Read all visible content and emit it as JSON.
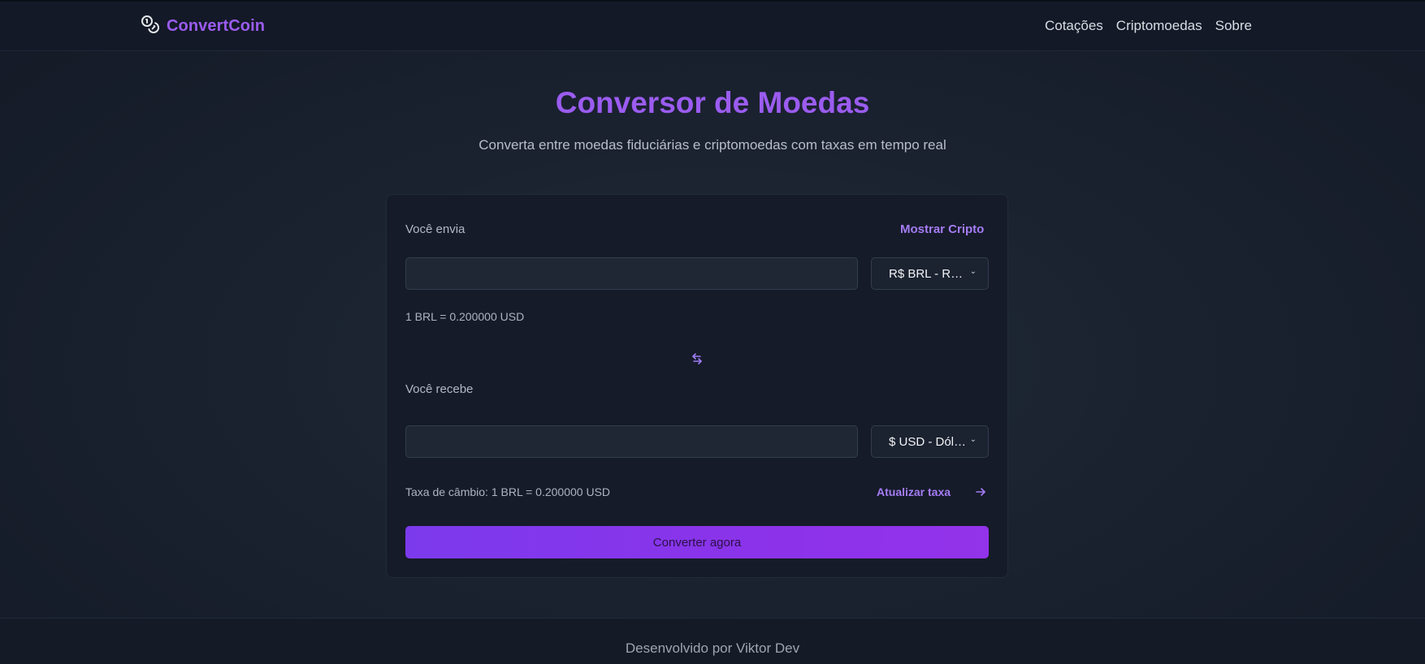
{
  "header": {
    "brand": "ConvertCoin",
    "nav": [
      "Cotações",
      "Criptomoedas",
      "Sobre"
    ]
  },
  "hero": {
    "title": "Conversor de Moedas",
    "subtitle": "Converta entre moedas fiduciárias e criptomoedas com taxas em tempo real"
  },
  "converter": {
    "send_label": "Você envia",
    "show_crypto": "Mostrar Cripto",
    "send_amount": "",
    "send_currency": "R$ BRL - Real Brasileiro",
    "send_rate": "1 BRL = 0.200000 USD",
    "receive_label": "Você recebe",
    "receive_amount": "",
    "receive_currency": "$ USD - Dólar Americano",
    "exchange_rate": "Taxa de câmbio: 1 BRL = 0.200000 USD",
    "refresh_rate": "Atualizar taxa",
    "convert_button": "Converter agora"
  },
  "footer": {
    "credit": "Desenvolvido por Viktor Dev"
  },
  "colors": {
    "accent": "#9b5cf0",
    "button": "#7c3aed",
    "background": "#1a2230"
  }
}
